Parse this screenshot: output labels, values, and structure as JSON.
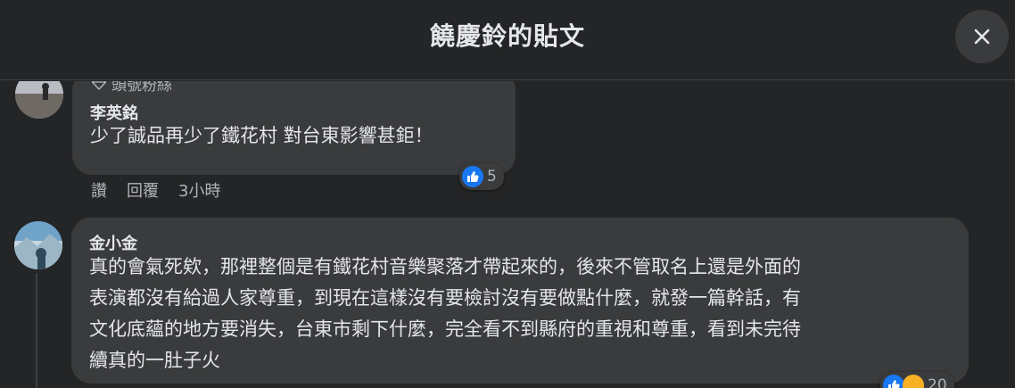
{
  "header": {
    "title": "饒慶鈴的貼文"
  },
  "comments": [
    {
      "badge": "頭號粉絲",
      "author": "李英銘",
      "text": "少了誠品再少了鐵花村 對台東影響甚鉅！",
      "actions": {
        "like": "讚",
        "reply": "回覆",
        "time": "3小時"
      },
      "reactions": {
        "count": "5"
      }
    },
    {
      "author": "金小金",
      "lines": [
        "真的會氣死欸，那裡整個是有鐵花村音樂聚落才帶起來的，後來不管取名上還是外面的",
        "表演都沒有給過人家尊重，到現在這樣沒有要檢討沒有要做點什麼，就發一篇幹話，有",
        "文化底蘊的地方要消失，台東市剩下什麼，完全看不到縣府的重視和尊重，看到未完待",
        "續真的一肚子火"
      ],
      "reactions": {
        "count": "20"
      }
    }
  ],
  "colors": {
    "background": "#242526",
    "bubble": "#3a3b3c",
    "like": "#1877f2",
    "muted": "#b0b3b8"
  },
  "icons": [
    "close-icon",
    "diamond-icon",
    "like-icon",
    "wow-icon"
  ]
}
